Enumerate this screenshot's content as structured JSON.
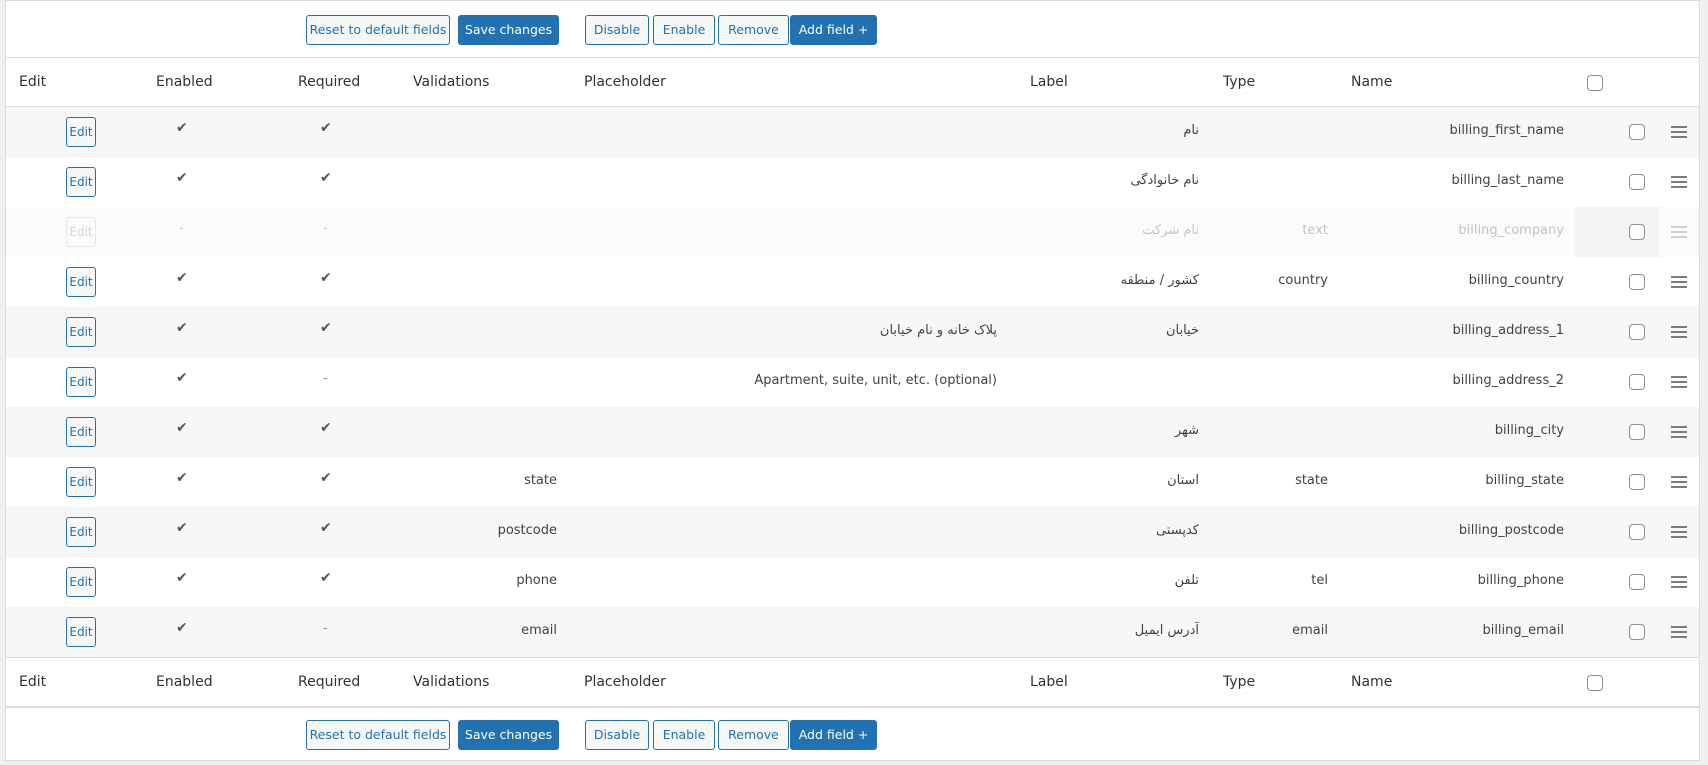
{
  "toolbar": {
    "reset_label": "Reset to default fields",
    "save_label": "Save changes",
    "disable_label": "Disable",
    "enable_label": "Enable",
    "remove_label": "Remove",
    "add_field_label": "Add field +"
  },
  "columns": {
    "edit": "Edit",
    "enabled": "Enabled",
    "required": "Required",
    "validations": "Validations",
    "placeholder": "Placeholder",
    "label": "Label",
    "type": "Type",
    "name": "Name"
  },
  "edit_button_label": "Edit",
  "rows": [
    {
      "name": "billing_first_name",
      "type": "",
      "label": "نام",
      "placeholder": "",
      "validations": "",
      "enabled": true,
      "required": true,
      "disabled_row": false
    },
    {
      "name": "billing_last_name",
      "type": "",
      "label": "نام خانوادگی",
      "placeholder": "",
      "validations": "",
      "enabled": true,
      "required": true,
      "disabled_row": false
    },
    {
      "name": "billing_company",
      "type": "text",
      "label": "نام شرکت",
      "placeholder": "",
      "validations": "",
      "enabled": false,
      "required": false,
      "disabled_row": true
    },
    {
      "name": "billing_country",
      "type": "country",
      "label": "کشور / منطقه",
      "placeholder": "",
      "validations": "",
      "enabled": true,
      "required": true,
      "disabled_row": false
    },
    {
      "name": "billing_address_1",
      "type": "",
      "label": "خیابان",
      "placeholder": "پلاک خانه و نام خیابان",
      "validations": "",
      "enabled": true,
      "required": true,
      "disabled_row": false
    },
    {
      "name": "billing_address_2",
      "type": "",
      "label": "",
      "placeholder": "Apartment, suite, unit, etc. (optional)",
      "validations": "",
      "enabled": true,
      "required": false,
      "disabled_row": false
    },
    {
      "name": "billing_city",
      "type": "",
      "label": "شهر",
      "placeholder": "",
      "validations": "",
      "enabled": true,
      "required": true,
      "disabled_row": false
    },
    {
      "name": "billing_state",
      "type": "state",
      "label": "استان",
      "placeholder": "",
      "validations": "state",
      "enabled": true,
      "required": true,
      "disabled_row": false
    },
    {
      "name": "billing_postcode",
      "type": "",
      "label": "کدپستی",
      "placeholder": "",
      "validations": "postcode",
      "enabled": true,
      "required": true,
      "disabled_row": false
    },
    {
      "name": "billing_phone",
      "type": "tel",
      "label": "تلفن",
      "placeholder": "",
      "validations": "phone",
      "enabled": true,
      "required": true,
      "disabled_row": false
    },
    {
      "name": "billing_email",
      "type": "email",
      "label": "آدرس ایمیل",
      "placeholder": "",
      "validations": "email",
      "enabled": true,
      "required": false,
      "disabled_row": false
    }
  ],
  "symbols": {
    "check": "✔",
    "dash": "-"
  }
}
